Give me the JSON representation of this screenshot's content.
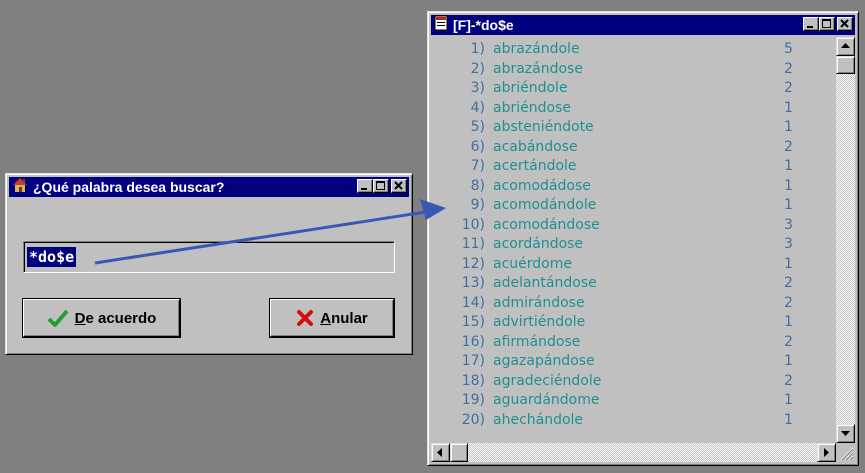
{
  "dialog": {
    "title": "¿Qué palabra desea buscar?",
    "input_value": "*do$e",
    "ok_label": "De acuerdo",
    "cancel_label": "Anular"
  },
  "listwin": {
    "title": "[F]-*do$e",
    "rows": [
      {
        "num": "1)",
        "word": "abrazándole",
        "count": "5"
      },
      {
        "num": "2)",
        "word": "abrazándose",
        "count": "2"
      },
      {
        "num": "3)",
        "word": "abriéndole",
        "count": "2"
      },
      {
        "num": "4)",
        "word": "abriéndose",
        "count": "1"
      },
      {
        "num": "5)",
        "word": "absteniéndote",
        "count": "1"
      },
      {
        "num": "6)",
        "word": "acabándose",
        "count": "2"
      },
      {
        "num": "7)",
        "word": "acertándole",
        "count": "1"
      },
      {
        "num": "8)",
        "word": "acomodádose",
        "count": "1"
      },
      {
        "num": "9)",
        "word": "acomodándole",
        "count": "1"
      },
      {
        "num": "10)",
        "word": "acomodándose",
        "count": "3"
      },
      {
        "num": "11)",
        "word": "acordándose",
        "count": "3"
      },
      {
        "num": "12)",
        "word": "acuérdome",
        "count": "1"
      },
      {
        "num": "13)",
        "word": "adelantándose",
        "count": "2"
      },
      {
        "num": "14)",
        "word": "admirándose",
        "count": "2"
      },
      {
        "num": "15)",
        "word": "advirtiéndole",
        "count": "1"
      },
      {
        "num": "16)",
        "word": "afirmándose",
        "count": "2"
      },
      {
        "num": "17)",
        "word": "agazapándose",
        "count": "1"
      },
      {
        "num": "18)",
        "word": "agradeciéndole",
        "count": "2"
      },
      {
        "num": "19)",
        "word": "aguardándome",
        "count": "1"
      },
      {
        "num": "20)",
        "word": "ahechándole",
        "count": "1"
      }
    ]
  },
  "colors": {
    "titlebar": "#000080",
    "word_text": "#20908f",
    "number_text": "#3f6fa0",
    "arrow": "#3a57b8"
  }
}
